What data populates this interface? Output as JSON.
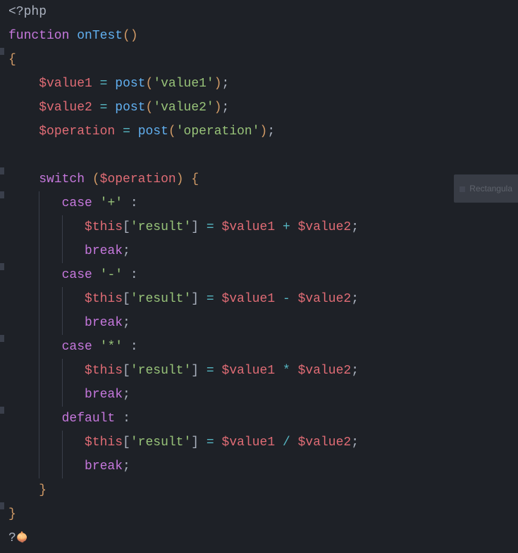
{
  "code": {
    "php_open": "<?php",
    "function_kw": "function",
    "func_name": "onTest",
    "open_brace": "{",
    "close_brace": "}",
    "var_value1": "$value1",
    "var_value2": "$value2",
    "var_operation": "$operation",
    "assign": "=",
    "post_call": "post",
    "str_value1": "'value1'",
    "str_value2": "'value2'",
    "str_operation": "'operation'",
    "semi": ";",
    "switch_kw": "switch",
    "case_kw": "case",
    "default_kw": "default",
    "break_kw": "break",
    "str_plus": "'+'",
    "str_minus": "'-'",
    "str_star": "'*'",
    "colon": ":",
    "this_var": "$this",
    "str_result": "'result'",
    "op_plus": "+",
    "op_minus": "-",
    "op_star": "*",
    "op_slash": "/",
    "php_close": "?",
    "paren_open": "(",
    "paren_close": ")",
    "bracket_open": "[",
    "bracket_close": "]"
  },
  "floating_label": "Rectangula",
  "emoji": "🧅"
}
